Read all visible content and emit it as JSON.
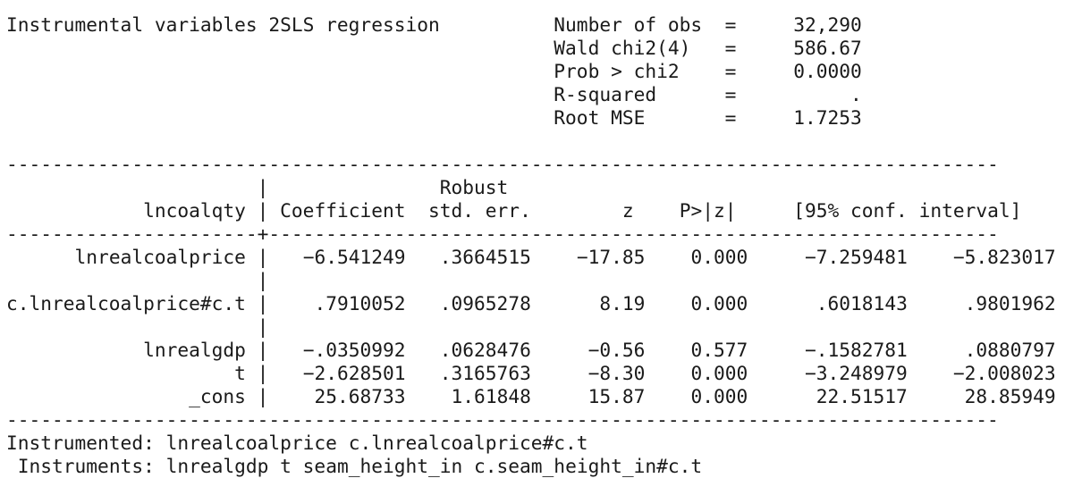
{
  "header": {
    "title": "Instrumental variables 2SLS regression",
    "stats": [
      {
        "label": "Number of obs",
        "eq": "=",
        "value": "32,290"
      },
      {
        "label": "Wald chi2(4)",
        "eq": "=",
        "value": "586.67"
      },
      {
        "label": "Prob > chi2",
        "eq": "=",
        "value": "0.0000"
      },
      {
        "label": "R-squared",
        "eq": "=",
        "value": "."
      },
      {
        "label": "Root MSE",
        "eq": "=",
        "value": "1.7253"
      }
    ]
  },
  "table": {
    "depvar": "lncoalqty",
    "header_robust": "Robust",
    "columns": [
      "Coefficient",
      "std. err.",
      "z",
      "P>|z|",
      "[95% conf. interval]"
    ],
    "rows": [
      {
        "name": "lnrealcoalprice",
        "coef": "-6.541249",
        "se": ".3664515",
        "z": "-17.85",
        "p": "0.000",
        "lo": "-7.259481",
        "hi": "-5.823017"
      },
      {
        "name": "c.lnrealcoalprice#c.t",
        "coef": ".7910052",
        "se": ".0965278",
        "z": "8.19",
        "p": "0.000",
        "lo": ".6018143",
        "hi": ".9801962"
      },
      {
        "name": "lnrealgdp",
        "coef": "-.0350992",
        "se": ".0628476",
        "z": "-0.56",
        "p": "0.577",
        "lo": "-.1582781",
        "hi": ".0880797"
      },
      {
        "name": "t",
        "coef": "-2.628501",
        "se": ".3165763",
        "z": "-8.30",
        "p": "0.000",
        "lo": "-3.248979",
        "hi": "-2.008023"
      },
      {
        "name": "_cons",
        "coef": "25.68733",
        "se": "1.61848",
        "z": "15.87",
        "p": "0.000",
        "lo": "22.51517",
        "hi": "28.85949"
      }
    ]
  },
  "footer": {
    "instrumented_label": "Instrumented:",
    "instrumented": "lnrealcoalprice c.lnrealcoalprice#c.t",
    "instruments_label": "Instruments:",
    "instruments": "lnrealgdp t seam_height_in c.seam_height_in#c.t"
  }
}
